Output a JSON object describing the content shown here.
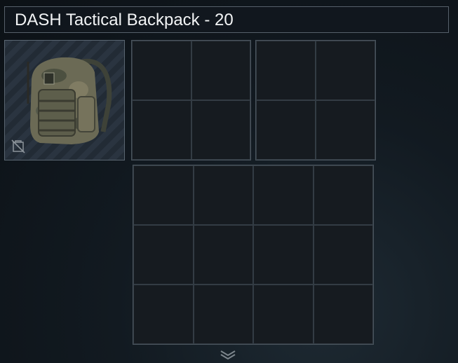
{
  "container": {
    "title": "DASH Tactical Backpack - 20",
    "item_icon": "backpack-icon",
    "item_badge_icon": "no-insure-icon"
  },
  "grids": [
    {
      "rows": 2,
      "cols": 2
    },
    {
      "rows": 2,
      "cols": 2
    },
    {
      "rows": 3,
      "cols": 4
    }
  ],
  "footer": {
    "expand_icon": "chevron-double-down-icon"
  },
  "colors": {
    "background": "#121a21",
    "cell": "#161b20",
    "border": "#4a545d",
    "title_text": "#f2f4f5"
  }
}
